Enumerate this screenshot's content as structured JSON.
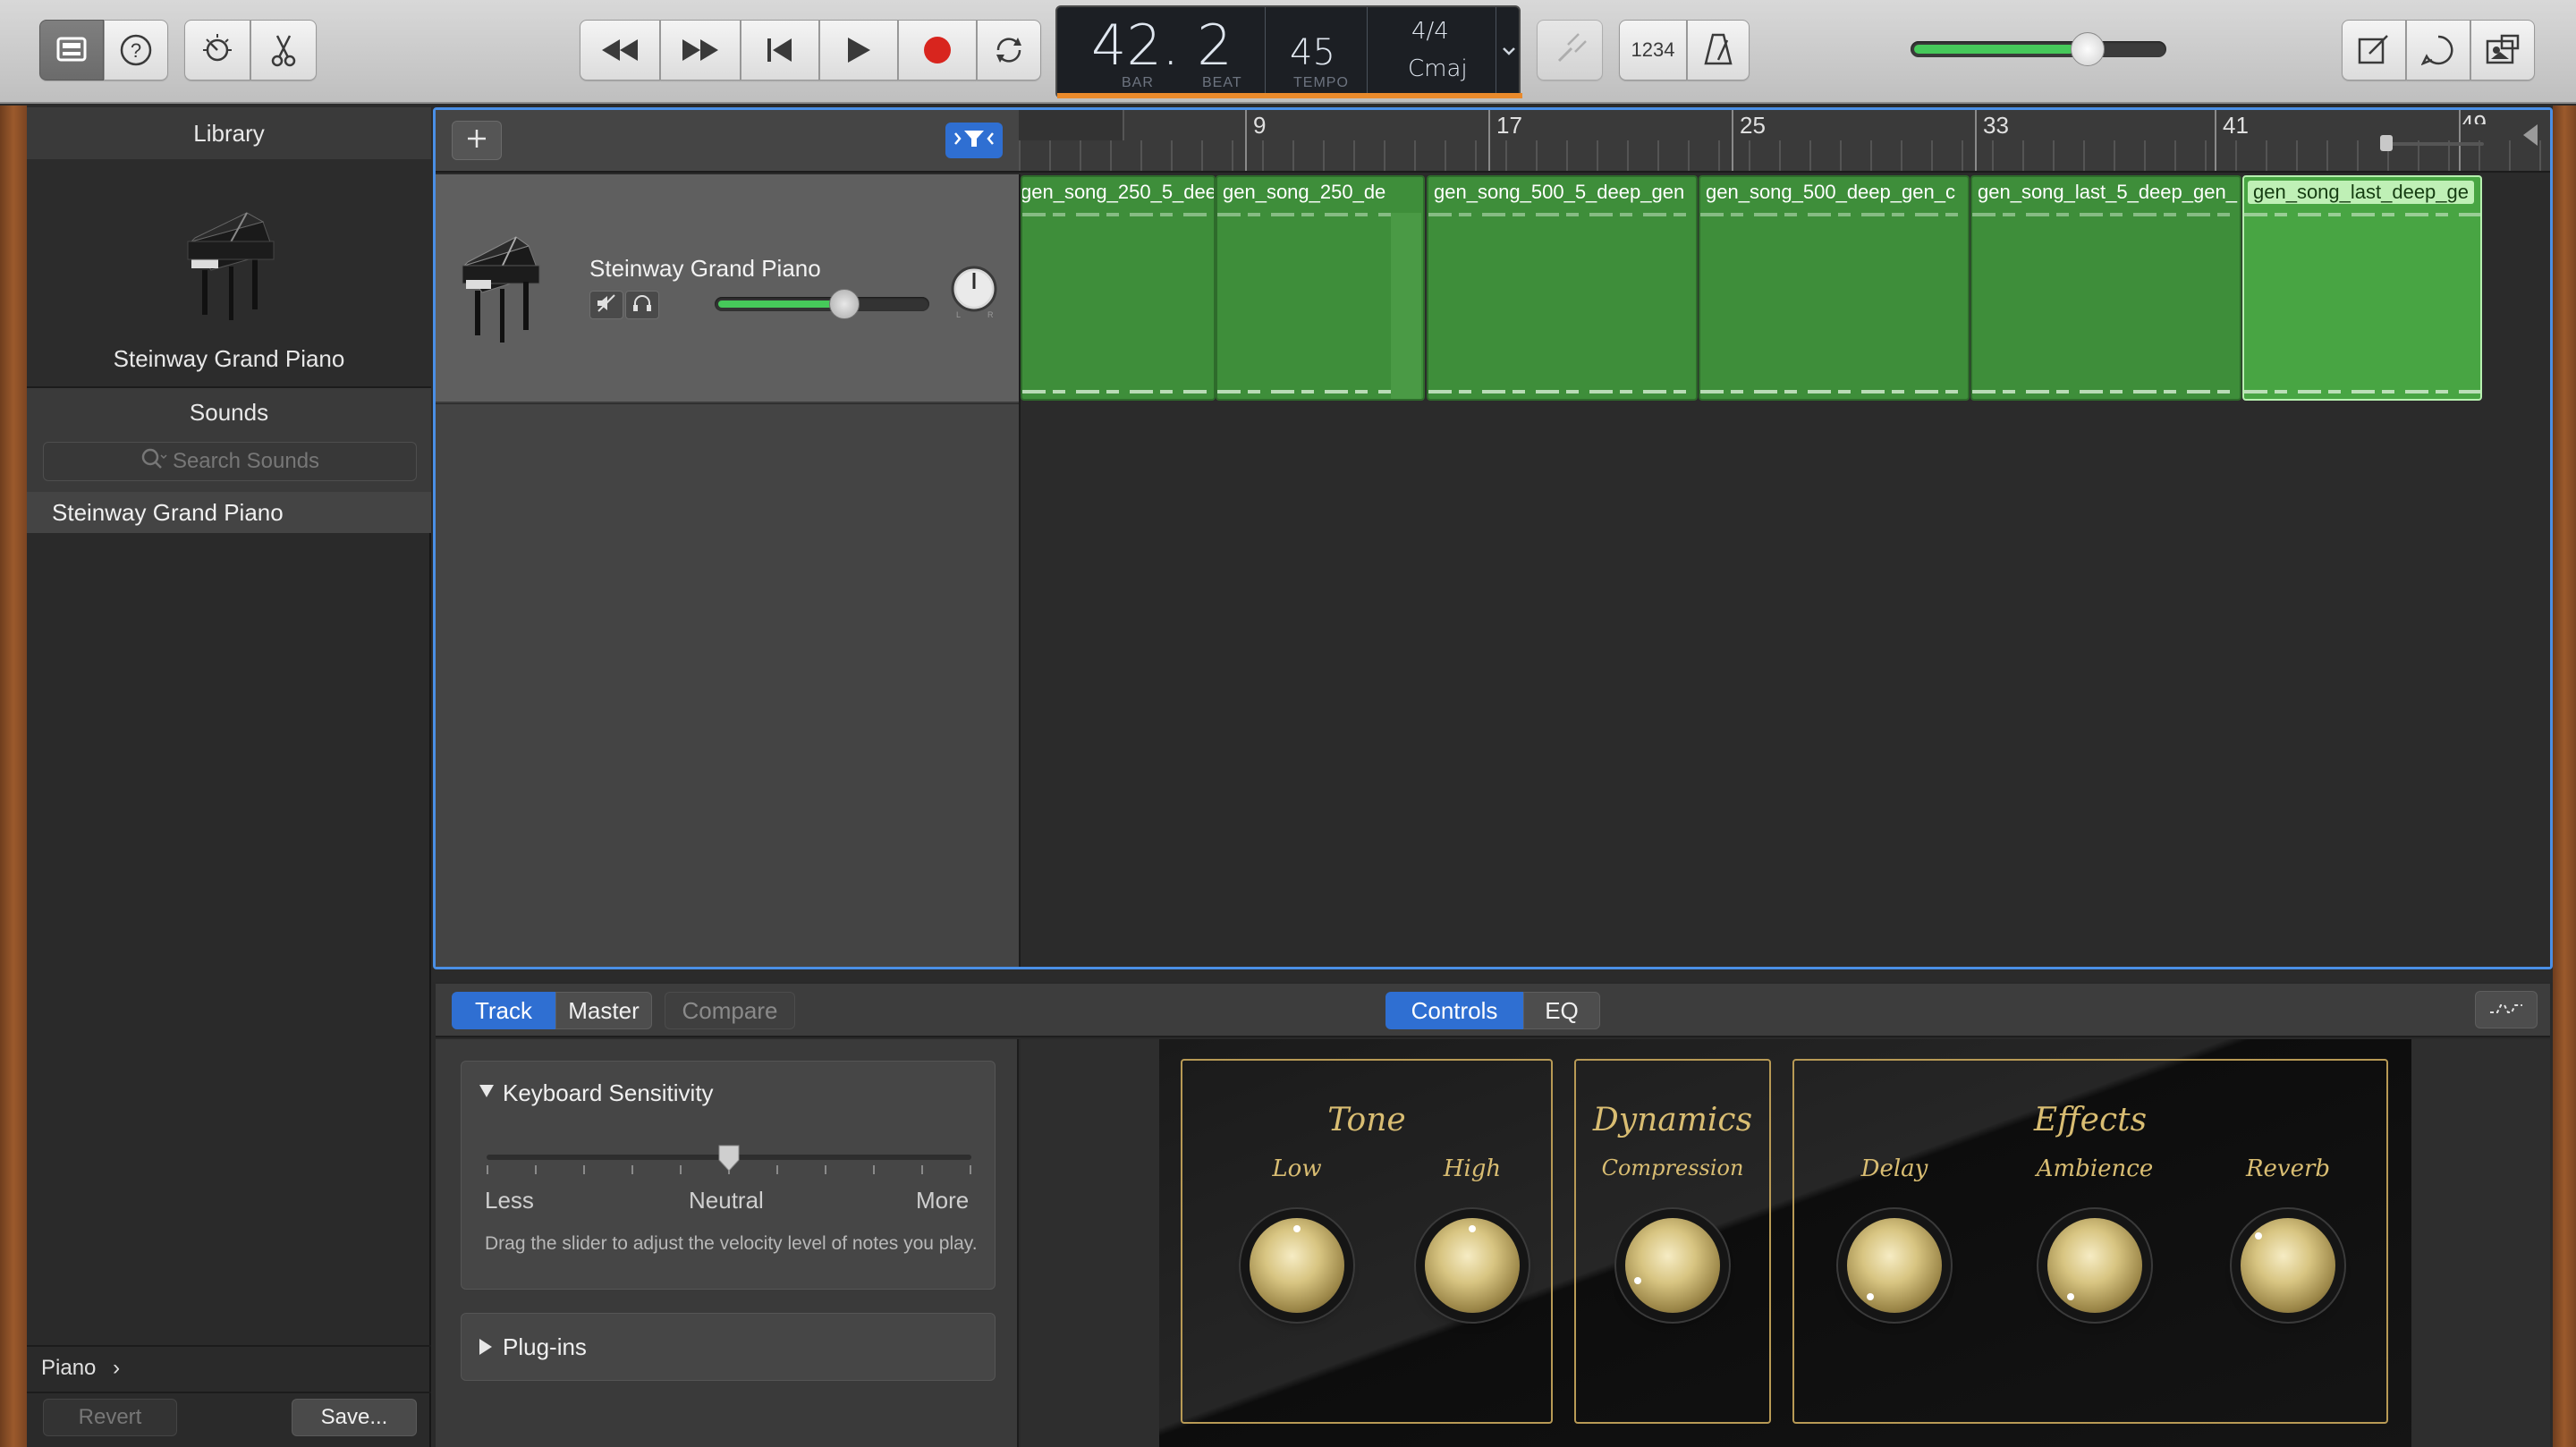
{
  "toolbar": {
    "lcd": {
      "bar_beat": "42. 2",
      "bar_label": "BAR",
      "beat_label": "BEAT",
      "tempo": "45",
      "tempo_label": "TEMPO",
      "signature": "4/4",
      "key": "Cmaj"
    },
    "count_in_label": "1234",
    "master_volume": 0.72
  },
  "library": {
    "title": "Library",
    "instrument_name": "Steinway Grand Piano",
    "sounds_title": "Sounds",
    "search_placeholder": "Search Sounds",
    "selected_item": "Steinway Grand Piano",
    "breadcrumb": "Piano",
    "revert_label": "Revert",
    "save_label": "Save..."
  },
  "track": {
    "name": "Steinway Grand Piano",
    "volume": 0.62
  },
  "ruler": {
    "marks": [
      "9",
      "17",
      "25",
      "33",
      "41",
      "49"
    ]
  },
  "regions": [
    {
      "name": "gen_song_250_5_dee"
    },
    {
      "name": "gen_song_250_de"
    },
    {
      "name": "gen_song_500_5_deep_gen"
    },
    {
      "name": "gen_song_500_deep_gen_c"
    },
    {
      "name": "gen_song_last_5_deep_gen_"
    },
    {
      "name": "gen_song_last_deep_ge"
    }
  ],
  "smart_controls": {
    "tabs": {
      "track": "Track",
      "master": "Master",
      "compare": "Compare",
      "controls": "Controls",
      "eq": "EQ"
    },
    "keyboard_sensitivity": {
      "title": "Keyboard Sensitivity",
      "less": "Less",
      "neutral": "Neutral",
      "more": "More",
      "help": "Drag the slider to adjust the velocity level of notes you play.",
      "value": 0.5
    },
    "plugins_title": "Plug-ins",
    "groups": {
      "tone": {
        "title": "Tone",
        "low": "Low",
        "high": "High"
      },
      "dynamics": {
        "title": "Dynamics",
        "compression": "Compression"
      },
      "effects": {
        "title": "Effects",
        "delay": "Delay",
        "ambience": "Ambience",
        "reverb": "Reverb"
      }
    }
  }
}
